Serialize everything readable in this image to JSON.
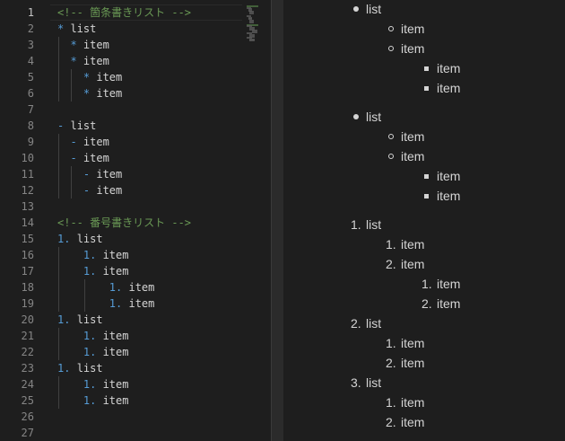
{
  "editor": {
    "lines": [
      {
        "n": "1",
        "parts": [
          {
            "t": "<!-- 箇条書きリスト -->",
            "c": "comment"
          }
        ]
      },
      {
        "n": "2",
        "parts": [
          {
            "t": "* ",
            "c": "bullet"
          },
          {
            "t": "list",
            "c": ""
          }
        ]
      },
      {
        "n": "3",
        "parts": [
          {
            "t": "  * ",
            "c": "bullet"
          },
          {
            "t": "item",
            "c": ""
          }
        ]
      },
      {
        "n": "4",
        "parts": [
          {
            "t": "  * ",
            "c": "bullet"
          },
          {
            "t": "item",
            "c": ""
          }
        ]
      },
      {
        "n": "5",
        "parts": [
          {
            "t": "    * ",
            "c": "bullet"
          },
          {
            "t": "item",
            "c": ""
          }
        ]
      },
      {
        "n": "6",
        "parts": [
          {
            "t": "    * ",
            "c": "bullet"
          },
          {
            "t": "item",
            "c": ""
          }
        ]
      },
      {
        "n": "7",
        "parts": []
      },
      {
        "n": "8",
        "parts": [
          {
            "t": "- ",
            "c": "bullet"
          },
          {
            "t": "list",
            "c": ""
          }
        ]
      },
      {
        "n": "9",
        "parts": [
          {
            "t": "  - ",
            "c": "bullet"
          },
          {
            "t": "item",
            "c": ""
          }
        ]
      },
      {
        "n": "10",
        "parts": [
          {
            "t": "  - ",
            "c": "bullet"
          },
          {
            "t": "item",
            "c": ""
          }
        ]
      },
      {
        "n": "11",
        "parts": [
          {
            "t": "    - ",
            "c": "bullet"
          },
          {
            "t": "item",
            "c": ""
          }
        ]
      },
      {
        "n": "12",
        "parts": [
          {
            "t": "    - ",
            "c": "bullet"
          },
          {
            "t": "item",
            "c": ""
          }
        ]
      },
      {
        "n": "13",
        "parts": []
      },
      {
        "n": "14",
        "parts": [
          {
            "t": "<!-- 番号書きリスト -->",
            "c": "comment"
          }
        ]
      },
      {
        "n": "15",
        "parts": [
          {
            "t": "1. ",
            "c": "num"
          },
          {
            "t": "list",
            "c": ""
          }
        ]
      },
      {
        "n": "16",
        "parts": [
          {
            "t": "    1. ",
            "c": "num"
          },
          {
            "t": "item",
            "c": ""
          }
        ]
      },
      {
        "n": "17",
        "parts": [
          {
            "t": "    1. ",
            "c": "num"
          },
          {
            "t": "item",
            "c": ""
          }
        ]
      },
      {
        "n": "18",
        "parts": [
          {
            "t": "        1. ",
            "c": "num"
          },
          {
            "t": "item",
            "c": ""
          }
        ]
      },
      {
        "n": "19",
        "parts": [
          {
            "t": "        1. ",
            "c": "num"
          },
          {
            "t": "item",
            "c": ""
          }
        ]
      },
      {
        "n": "20",
        "parts": [
          {
            "t": "1. ",
            "c": "num"
          },
          {
            "t": "list",
            "c": ""
          }
        ]
      },
      {
        "n": "21",
        "parts": [
          {
            "t": "    1. ",
            "c": "num"
          },
          {
            "t": "item",
            "c": ""
          }
        ]
      },
      {
        "n": "22",
        "parts": [
          {
            "t": "    1. ",
            "c": "num"
          },
          {
            "t": "item",
            "c": ""
          }
        ]
      },
      {
        "n": "23",
        "parts": [
          {
            "t": "1. ",
            "c": "num"
          },
          {
            "t": "list",
            "c": ""
          }
        ]
      },
      {
        "n": "24",
        "parts": [
          {
            "t": "    1. ",
            "c": "num"
          },
          {
            "t": "item",
            "c": ""
          }
        ]
      },
      {
        "n": "25",
        "parts": [
          {
            "t": "    1. ",
            "c": "num"
          },
          {
            "t": "item",
            "c": ""
          }
        ]
      },
      {
        "n": "26",
        "parts": []
      },
      {
        "n": "27",
        "parts": []
      }
    ]
  },
  "preview": {
    "items": [
      {
        "marker": "disc",
        "text": "list",
        "level": 0
      },
      {
        "marker": "circle",
        "text": "item",
        "level": 1
      },
      {
        "marker": "circle",
        "text": "item",
        "level": 1
      },
      {
        "marker": "square",
        "text": "item",
        "level": 2
      },
      {
        "marker": "square",
        "text": "item",
        "level": 2
      },
      {
        "marker": "gap",
        "text": "",
        "level": 0
      },
      {
        "marker": "disc",
        "text": "list",
        "level": 0
      },
      {
        "marker": "circle",
        "text": "item",
        "level": 1
      },
      {
        "marker": "circle",
        "text": "item",
        "level": 1
      },
      {
        "marker": "square",
        "text": "item",
        "level": 2
      },
      {
        "marker": "square",
        "text": "item",
        "level": 2
      },
      {
        "marker": "gap",
        "text": "",
        "level": 0
      },
      {
        "marker": "1.",
        "text": "list",
        "level": 0
      },
      {
        "marker": "1.",
        "text": "item",
        "level": 1
      },
      {
        "marker": "2.",
        "text": "item",
        "level": 1
      },
      {
        "marker": "1.",
        "text": "item",
        "level": 2
      },
      {
        "marker": "2.",
        "text": "item",
        "level": 2
      },
      {
        "marker": "2.",
        "text": "list",
        "level": 0
      },
      {
        "marker": "1.",
        "text": "item",
        "level": 1
      },
      {
        "marker": "2.",
        "text": "item",
        "level": 1
      },
      {
        "marker": "3.",
        "text": "list",
        "level": 0
      },
      {
        "marker": "1.",
        "text": "item",
        "level": 1
      },
      {
        "marker": "2.",
        "text": "item",
        "level": 1
      }
    ]
  },
  "colors": {
    "background": "#1e1e1e",
    "comment": "#6a9955",
    "keyword": "#569cd6",
    "text": "#d4d4d4",
    "line_number": "#858585"
  }
}
